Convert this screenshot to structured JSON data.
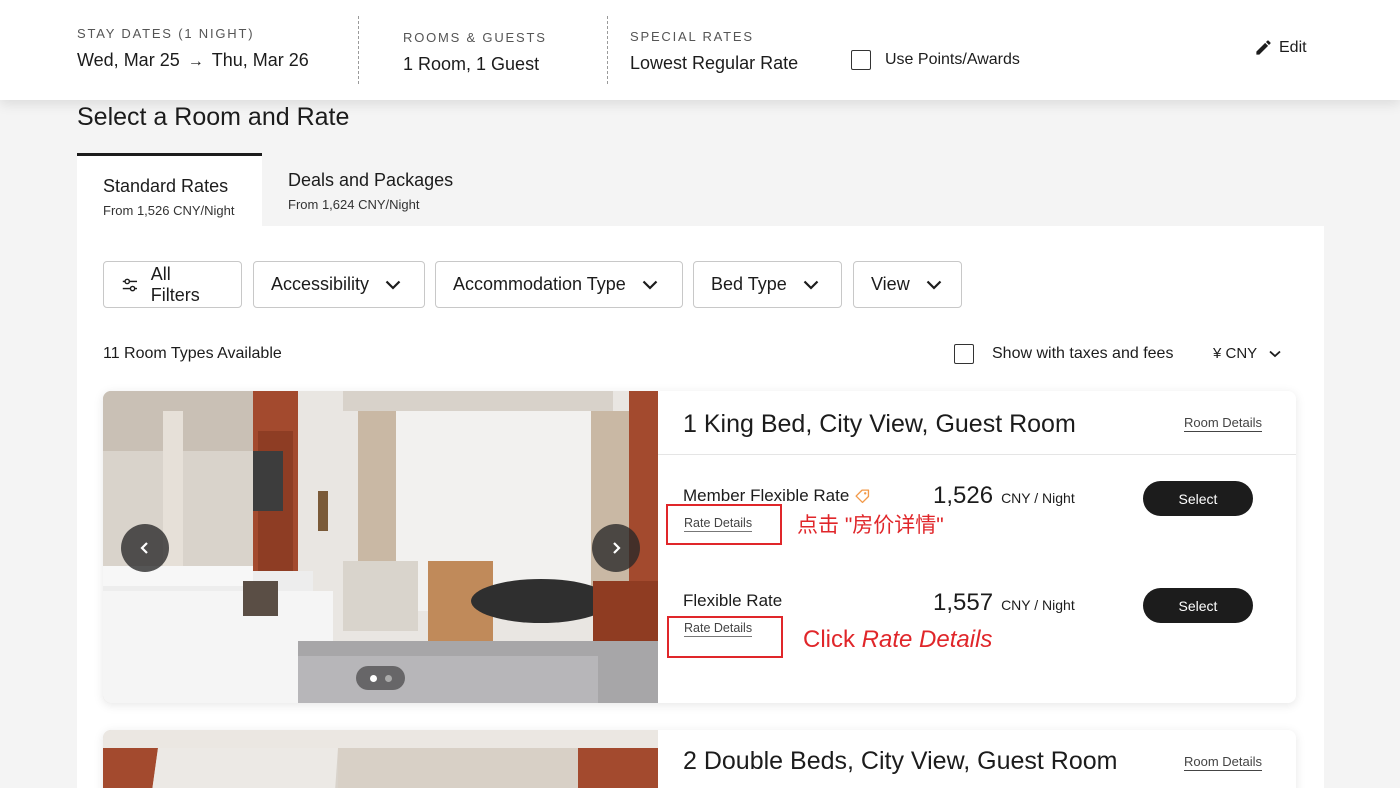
{
  "header": {
    "stay_label": "STAY DATES (1 NIGHT)",
    "check_in": "Wed, Mar 25",
    "check_out": "Thu, Mar 26",
    "rooms_label": "ROOMS & GUESTS",
    "rooms_value": "1 Room, 1 Guest",
    "special_label": "SPECIAL RATES",
    "special_value": "Lowest Regular Rate",
    "use_points_label": "Use Points/Awards",
    "use_points_checked": false,
    "edit_label": "Edit"
  },
  "page": {
    "title": "Select a Room and Rate"
  },
  "tabs": [
    {
      "name": "Standard Rates",
      "from": "From 1,526 CNY/Night",
      "active": true
    },
    {
      "name": "Deals and Packages",
      "from": "From 1,624 CNY/Night",
      "active": false
    }
  ],
  "filters": {
    "all_filters": "All Filters",
    "accessibility": "Accessibility",
    "accommodation_type": "Accommodation Type",
    "bed_type": "Bed Type",
    "view": "View"
  },
  "results": {
    "count": "11 Room Types Available",
    "taxes_label": "Show with taxes and fees",
    "taxes_checked": false,
    "currency": "¥ CNY"
  },
  "rooms": [
    {
      "title": "1 King Bed, City View, Guest Room",
      "details_link": "Room Details",
      "rates": [
        {
          "name": "Member Flexible Rate",
          "details": "Rate Details",
          "amount": "1,526",
          "unit": "CNY / Night",
          "select": "Select"
        },
        {
          "name": "Flexible Rate",
          "details": "Rate Details",
          "amount": "1,557",
          "unit": "CNY / Night",
          "select": "Select"
        }
      ]
    },
    {
      "title": "2 Double Beds, City View, Guest Room",
      "details_link": "Room Details"
    }
  ],
  "annotations": {
    "cn": "点击 \"房价详情\"",
    "en_prefix": "Click ",
    "en_emph": "Rate Details"
  },
  "colors": {
    "accent_dark": "#1c1c1c",
    "annotation_red": "#e0262a",
    "tag_orange": "#f29a4a"
  }
}
